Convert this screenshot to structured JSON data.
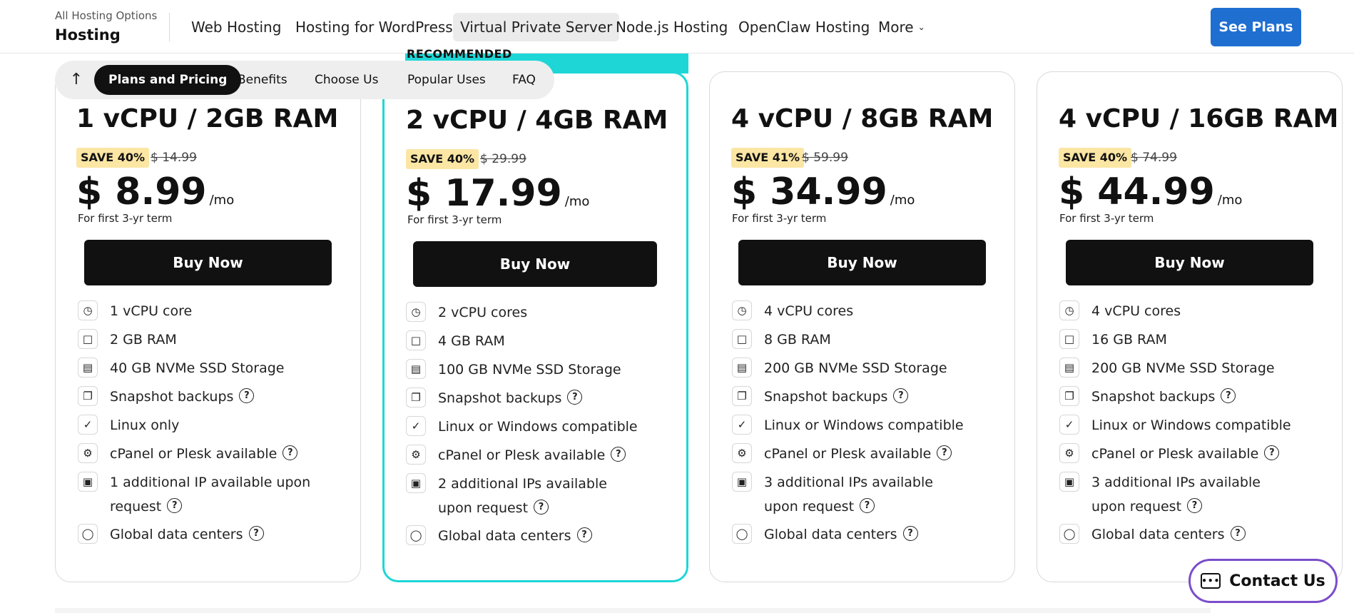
{
  "header": {
    "brand_sub": "All Hosting Options",
    "brand_title": "Hosting",
    "links": [
      "Web Hosting",
      "Hosting for WordPress",
      "Virtual Private Server",
      "Node.js Hosting",
      "OpenClaw Hosting",
      "More"
    ],
    "active_link": "Virtual Private Server",
    "cta": "See Plans",
    "accent_color": "#1f6fd1"
  },
  "section_tabs": {
    "items": [
      "Plans and Pricing",
      "Benefits",
      "Choose Us",
      "Popular Uses",
      "FAQ"
    ],
    "active": "Plans and Pricing",
    "back_icon": "arrow-up-icon"
  },
  "recommended_label": "RECOMMENDED",
  "recommended_color": "#1fd6d6",
  "plans": [
    {
      "name": "1 vCPU / 2GB RAM",
      "save": "SAVE 40%",
      "old_price": "$ 14.99",
      "price": "$ 8.99",
      "per": "/mo",
      "term": "For first 3-yr term",
      "buy": "Buy Now",
      "features": [
        "1 vCPU core",
        "2 GB RAM",
        "40 GB NVMe SSD Storage",
        "Snapshot backups",
        "Linux only",
        "cPanel or Plesk available",
        "1 additional IP available upon request",
        "Global data centers"
      ]
    },
    {
      "name": "2 vCPU / 4GB RAM",
      "save": "SAVE 40%",
      "old_price": "$ 29.99",
      "price": "$ 17.99",
      "per": "/mo",
      "term": "For first 3-yr term",
      "buy": "Buy Now",
      "features": [
        "2 vCPU cores",
        "4 GB RAM",
        "100 GB NVMe SSD Storage",
        "Snapshot backups",
        "Linux or Windows compatible",
        "cPanel or Plesk available",
        "2 additional IPs available upon request",
        "Global data centers"
      ]
    },
    {
      "name": "4 vCPU / 8GB RAM",
      "save": "SAVE 41%",
      "old_price": "$ 59.99",
      "price": "$ 34.99",
      "per": "/mo",
      "term": "For first 3-yr term",
      "buy": "Buy Now",
      "features": [
        "4 vCPU cores",
        "8 GB RAM",
        "200 GB NVMe SSD Storage",
        "Snapshot backups",
        "Linux or Windows compatible",
        "cPanel or Plesk available",
        "3 additional IPs available upon request",
        "Global data centers"
      ]
    },
    {
      "name": "4 vCPU / 16GB RAM",
      "save": "SAVE 40%",
      "old_price": "$ 74.99",
      "price": "$ 44.99",
      "per": "/mo",
      "term": "For first 3-yr term",
      "buy": "Buy Now",
      "features": [
        "4 vCPU cores",
        "16 GB RAM",
        "200 GB NVMe SSD Storage",
        "Snapshot backups",
        "Linux or Windows compatible",
        "cPanel or Plesk available",
        "3 additional IPs available upon request",
        "Global data centers"
      ]
    }
  ],
  "feature_icons": [
    "gauge-icon",
    "monitor-icon",
    "drive-icon",
    "copy-icon",
    "check-icon",
    "gear-icon",
    "window-icon",
    "globe-icon"
  ],
  "contact": "Contact Us",
  "contact_border_color": "#7a4dc9"
}
